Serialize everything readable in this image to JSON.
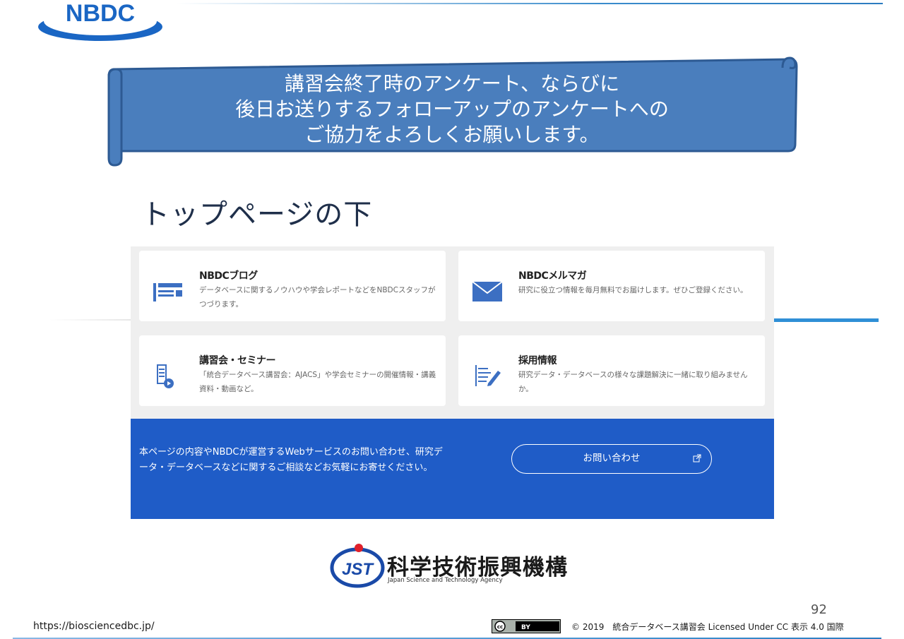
{
  "header": {
    "logo_text": "NBDC"
  },
  "banner": {
    "lines": [
      "講習会終了時のアンケート、ならびに",
      "後日お送りするフォローアップのアンケートへの",
      "ご協力をよろしくお願いします。"
    ]
  },
  "section_heading": "トップページの下",
  "cards": [
    {
      "title": "NBDCブログ",
      "desc": "データベースに関するノウハウや学会レポートなどをNBDCスタッフがつづります。",
      "icon": "blog-icon"
    },
    {
      "title": "NBDCメルマガ",
      "desc": "研究に役立つ情報を毎月無料でお届けします。ぜひご登録ください。",
      "icon": "mail-icon"
    },
    {
      "title": "講習会・セミナー",
      "desc": "「統合データベース講習会：AJACS」や学会セミナーの開催情報・講義資料・動画など。",
      "icon": "seminar-icon"
    },
    {
      "title": "採用情報",
      "desc": "研究データ・データベースの様々な課題解決に一緒に取り組みませんか。",
      "icon": "recruit-icon"
    }
  ],
  "cta": {
    "text": "本ページの内容やNBDCが運営するWebサービスのお問い合わせ、研究データ・データベースなどに関するご相談などお気軽にお寄せください。",
    "button_label": "お問い合わせ"
  },
  "jst": {
    "logo_text": "JST",
    "name": "科学技術振興機構",
    "name_en": "Japan Science and Technology Agency"
  },
  "footer": {
    "page_number": "92",
    "url": "https://biosciencedbc.jp/",
    "cc_badge": "cc BY",
    "copyright": "© 2019　統合データベース講習会 Licensed Under CC 表示 4.0 国際"
  },
  "colors": {
    "banner": "#4a7ebd",
    "cta": "#1f5cc7",
    "logo": "#1a66c4",
    "accent_rule": "#2f8fd6"
  }
}
